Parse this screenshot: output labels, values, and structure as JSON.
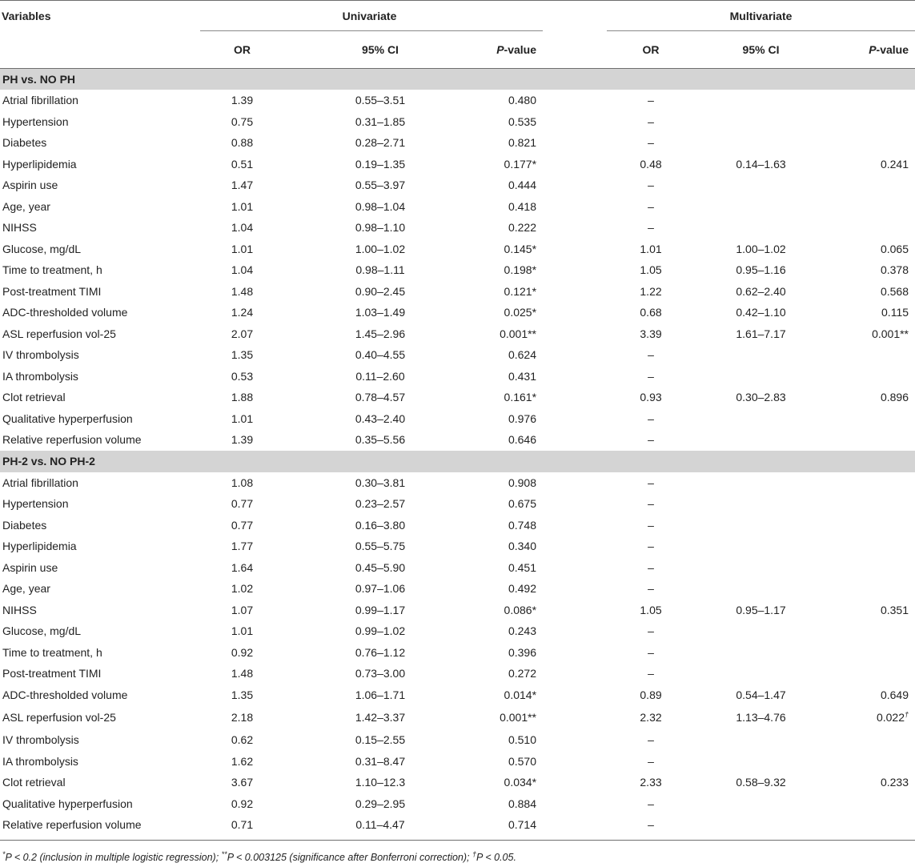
{
  "headers": {
    "variables": "Variables",
    "univariate": "Univariate",
    "multivariate": "Multivariate",
    "or": "OR",
    "ci": "95% CI",
    "p_prefix": "P",
    "p_suffix": "-value"
  },
  "sections": [
    {
      "title": "PH vs. NO PH",
      "rows": [
        {
          "label": "Atrial fibrillation",
          "u_or": "1.39",
          "u_ci": "0.55–3.51",
          "u_p": "0.480",
          "m_or": "–",
          "m_ci": "",
          "m_p": ""
        },
        {
          "label": "Hypertension",
          "u_or": "0.75",
          "u_ci": "0.31–1.85",
          "u_p": "0.535",
          "m_or": "–",
          "m_ci": "",
          "m_p": ""
        },
        {
          "label": "Diabetes",
          "u_or": "0.88",
          "u_ci": "0.28–2.71",
          "u_p": "0.821",
          "m_or": "–",
          "m_ci": "",
          "m_p": ""
        },
        {
          "label": "Hyperlipidemia",
          "u_or": "0.51",
          "u_ci": "0.19–1.35",
          "u_p": "0.177*",
          "m_or": "0.48",
          "m_ci": "0.14–1.63",
          "m_p": "0.241"
        },
        {
          "label": "Aspirin use",
          "u_or": "1.47",
          "u_ci": "0.55–3.97",
          "u_p": "0.444",
          "m_or": "–",
          "m_ci": "",
          "m_p": ""
        },
        {
          "label": "Age, year",
          "u_or": "1.01",
          "u_ci": "0.98–1.04",
          "u_p": "0.418",
          "m_or": "–",
          "m_ci": "",
          "m_p": ""
        },
        {
          "label": "NIHSS",
          "u_or": "1.04",
          "u_ci": "0.98–1.10",
          "u_p": "0.222",
          "m_or": "–",
          "m_ci": "",
          "m_p": ""
        },
        {
          "label": "Glucose, mg/dL",
          "u_or": "1.01",
          "u_ci": "1.00–1.02",
          "u_p": "0.145*",
          "m_or": "1.01",
          "m_ci": "1.00–1.02",
          "m_p": "0.065"
        },
        {
          "label": "Time to treatment, h",
          "u_or": "1.04",
          "u_ci": "0.98–1.11",
          "u_p": "0.198*",
          "m_or": "1.05",
          "m_ci": "0.95–1.16",
          "m_p": "0.378"
        },
        {
          "label": "Post-treatment TIMI",
          "u_or": "1.48",
          "u_ci": "0.90–2.45",
          "u_p": "0.121*",
          "m_or": "1.22",
          "m_ci": "0.62–2.40",
          "m_p": "0.568"
        },
        {
          "label": "ADC-thresholded volume",
          "u_or": "1.24",
          "u_ci": "1.03–1.49",
          "u_p": "0.025*",
          "m_or": "0.68",
          "m_ci": "0.42–1.10",
          "m_p": "0.115"
        },
        {
          "label": "ASL reperfusion vol-25",
          "u_or": "2.07",
          "u_ci": "1.45–2.96",
          "u_p": "0.001**",
          "m_or": "3.39",
          "m_ci": "1.61–7.17",
          "m_p": "0.001**"
        },
        {
          "label": "IV thrombolysis",
          "u_or": "1.35",
          "u_ci": "0.40–4.55",
          "u_p": "0.624",
          "m_or": "–",
          "m_ci": "",
          "m_p": ""
        },
        {
          "label": "IA thrombolysis",
          "u_or": "0.53",
          "u_ci": "0.11–2.60",
          "u_p": "0.431",
          "m_or": "–",
          "m_ci": "",
          "m_p": ""
        },
        {
          "label": "Clot retrieval",
          "u_or": "1.88",
          "u_ci": "0.78–4.57",
          "u_p": "0.161*",
          "m_or": "0.93",
          "m_ci": "0.30–2.83",
          "m_p": "0.896"
        },
        {
          "label": "Qualitative hyperperfusion",
          "u_or": "1.01",
          "u_ci": "0.43–2.40",
          "u_p": "0.976",
          "m_or": "–",
          "m_ci": "",
          "m_p": ""
        },
        {
          "label": "Relative reperfusion volume",
          "u_or": "1.39",
          "u_ci": "0.35–5.56",
          "u_p": "0.646",
          "m_or": "–",
          "m_ci": "",
          "m_p": ""
        }
      ]
    },
    {
      "title": "PH-2 vs. NO PH-2",
      "rows": [
        {
          "label": "Atrial fibrillation",
          "u_or": "1.08",
          "u_ci": "0.30–3.81",
          "u_p": "0.908",
          "m_or": "–",
          "m_ci": "",
          "m_p": ""
        },
        {
          "label": "Hypertension",
          "u_or": "0.77",
          "u_ci": "0.23–2.57",
          "u_p": "0.675",
          "m_or": "–",
          "m_ci": "",
          "m_p": ""
        },
        {
          "label": "Diabetes",
          "u_or": "0.77",
          "u_ci": "0.16–3.80",
          "u_p": "0.748",
          "m_or": "–",
          "m_ci": "",
          "m_p": ""
        },
        {
          "label": "Hyperlipidemia",
          "u_or": "1.77",
          "u_ci": "0.55–5.75",
          "u_p": "0.340",
          "m_or": "–",
          "m_ci": "",
          "m_p": ""
        },
        {
          "label": "Aspirin use",
          "u_or": "1.64",
          "u_ci": "0.45–5.90",
          "u_p": "0.451",
          "m_or": "–",
          "m_ci": "",
          "m_p": ""
        },
        {
          "label": "Age, year",
          "u_or": "1.02",
          "u_ci": "0.97–1.06",
          "u_p": "0.492",
          "m_or": "–",
          "m_ci": "",
          "m_p": ""
        },
        {
          "label": "NIHSS",
          "u_or": "1.07",
          "u_ci": "0.99–1.17",
          "u_p": "0.086*",
          "m_or": "1.05",
          "m_ci": "0.95–1.17",
          "m_p": "0.351"
        },
        {
          "label": "Glucose, mg/dL",
          "u_or": "1.01",
          "u_ci": "0.99–1.02",
          "u_p": "0.243",
          "m_or": "–",
          "m_ci": "",
          "m_p": ""
        },
        {
          "label": "Time to treatment, h",
          "u_or": "0.92",
          "u_ci": "0.76–1.12",
          "u_p": "0.396",
          "m_or": "–",
          "m_ci": "",
          "m_p": ""
        },
        {
          "label": "Post-treatment TIMI",
          "u_or": "1.48",
          "u_ci": "0.73–3.00",
          "u_p": "0.272",
          "m_or": "–",
          "m_ci": "",
          "m_p": ""
        },
        {
          "label": "ADC-thresholded volume",
          "u_or": "1.35",
          "u_ci": "1.06–1.71",
          "u_p": "0.014*",
          "m_or": "0.89",
          "m_ci": "0.54–1.47",
          "m_p": "0.649"
        },
        {
          "label": "ASL reperfusion vol-25",
          "u_or": "2.18",
          "u_ci": "1.42–3.37",
          "u_p": "0.001**",
          "m_or": "2.32",
          "m_ci": "1.13–4.76",
          "m_p": "0.022",
          "m_p_sup": "†",
          "tall": true
        },
        {
          "label": "IV thrombolysis",
          "u_or": "0.62",
          "u_ci": "0.15–2.55",
          "u_p": "0.510",
          "m_or": "–",
          "m_ci": "",
          "m_p": ""
        },
        {
          "label": "IA thrombolysis",
          "u_or": "1.62",
          "u_ci": "0.31–8.47",
          "u_p": "0.570",
          "m_or": "–",
          "m_ci": "",
          "m_p": ""
        },
        {
          "label": "Clot retrieval",
          "u_or": "3.67",
          "u_ci": "1.10–12.3",
          "u_p": "0.034*",
          "m_or": "2.33",
          "m_ci": "0.58–9.32",
          "m_p": "0.233"
        },
        {
          "label": "Qualitative hyperperfusion",
          "u_or": "0.92",
          "u_ci": "0.29–2.95",
          "u_p": "0.884",
          "m_or": "–",
          "m_ci": "",
          "m_p": ""
        },
        {
          "label": "Relative reperfusion volume",
          "u_or": "0.71",
          "u_ci": "0.11–4.47",
          "u_p": "0.714",
          "m_or": "–",
          "m_ci": "",
          "m_p": ""
        }
      ]
    }
  ],
  "footnote": {
    "s1": "*",
    "t1": "P < 0.2 (inclusion in multiple logistic regression); ",
    "s2": "**",
    "t2": "P < 0.003125 (significance after Bonferroni correction); ",
    "s3": "†",
    "t3": "P < 0.05."
  }
}
